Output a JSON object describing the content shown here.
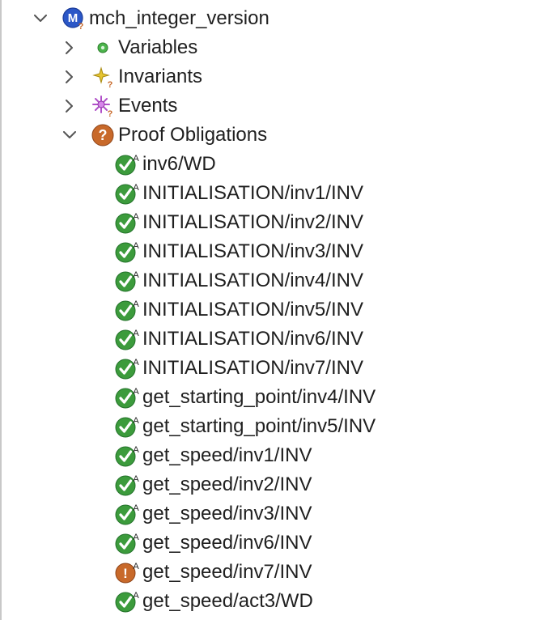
{
  "tree": {
    "clipped_top_text": "~ ~ ~ ~ ~",
    "machine": {
      "label": "mch_integer_version",
      "icon": "machine-icon",
      "expanded": true
    },
    "sections": [
      {
        "id": "variables",
        "label": "Variables",
        "icon": "variables-icon",
        "expanded": false
      },
      {
        "id": "invariants",
        "label": "Invariants",
        "icon": "invariants-icon",
        "expanded": false
      },
      {
        "id": "events",
        "label": "Events",
        "icon": "events-icon",
        "expanded": false
      },
      {
        "id": "proof-obligations",
        "label": "Proof Obligations",
        "icon": "proof-obligations-icon",
        "expanded": true
      }
    ],
    "proof_obligations": [
      {
        "label": "inv6/WD",
        "status": "discharged"
      },
      {
        "label": "INITIALISATION/inv1/INV",
        "status": "discharged"
      },
      {
        "label": "INITIALISATION/inv2/INV",
        "status": "discharged"
      },
      {
        "label": "INITIALISATION/inv3/INV",
        "status": "discharged"
      },
      {
        "label": "INITIALISATION/inv4/INV",
        "status": "discharged"
      },
      {
        "label": "INITIALISATION/inv5/INV",
        "status": "discharged"
      },
      {
        "label": "INITIALISATION/inv6/INV",
        "status": "discharged"
      },
      {
        "label": "INITIALISATION/inv7/INV",
        "status": "discharged"
      },
      {
        "label": "get_starting_point/inv4/INV",
        "status": "discharged"
      },
      {
        "label": "get_starting_point/inv5/INV",
        "status": "discharged"
      },
      {
        "label": "get_speed/inv1/INV",
        "status": "discharged"
      },
      {
        "label": "get_speed/inv2/INV",
        "status": "discharged"
      },
      {
        "label": "get_speed/inv3/INV",
        "status": "discharged"
      },
      {
        "label": "get_speed/inv6/INV",
        "status": "discharged"
      },
      {
        "label": "get_speed/inv7/INV",
        "status": "undischarged"
      },
      {
        "label": "get_speed/act3/WD",
        "status": "discharged"
      }
    ],
    "colors": {
      "discharged_green": "#3c9b3c",
      "undischarged_orange": "#c8692a",
      "machine_blue": "#2b57c7",
      "chevron_gray": "#555555"
    }
  }
}
